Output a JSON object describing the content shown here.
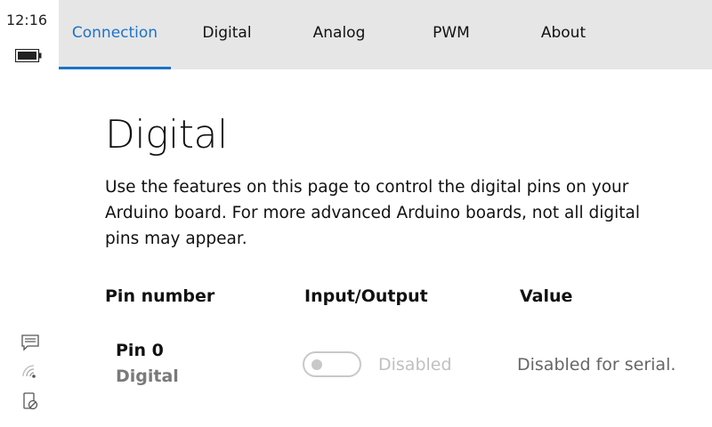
{
  "status": {
    "time": "12:16",
    "battery_icon": "battery-icon",
    "icons": [
      "message-icon",
      "wifi-icon",
      "phone-blocked-icon"
    ]
  },
  "tabs": [
    {
      "label": "Connection",
      "active": true
    },
    {
      "label": "Digital",
      "active": false
    },
    {
      "label": "Analog",
      "active": false
    },
    {
      "label": "PWM",
      "active": false
    },
    {
      "label": "About",
      "active": false
    }
  ],
  "page": {
    "title": "Digital",
    "description": "Use the features on this page to control the digital pins on your Arduino board. For more advanced Arduino boards, not all digital pins may appear."
  },
  "table": {
    "headers": {
      "pin_number": "Pin number",
      "io": "Input/Output",
      "value": "Value"
    },
    "rows": [
      {
        "pin": "Pin 0",
        "type": "Digital",
        "toggle_state": "Disabled",
        "value": "Disabled for serial."
      }
    ]
  },
  "colors": {
    "accent": "#1a73c9",
    "tabbar_bg": "#e6e6e6",
    "disabled": "#c0c0c0"
  }
}
